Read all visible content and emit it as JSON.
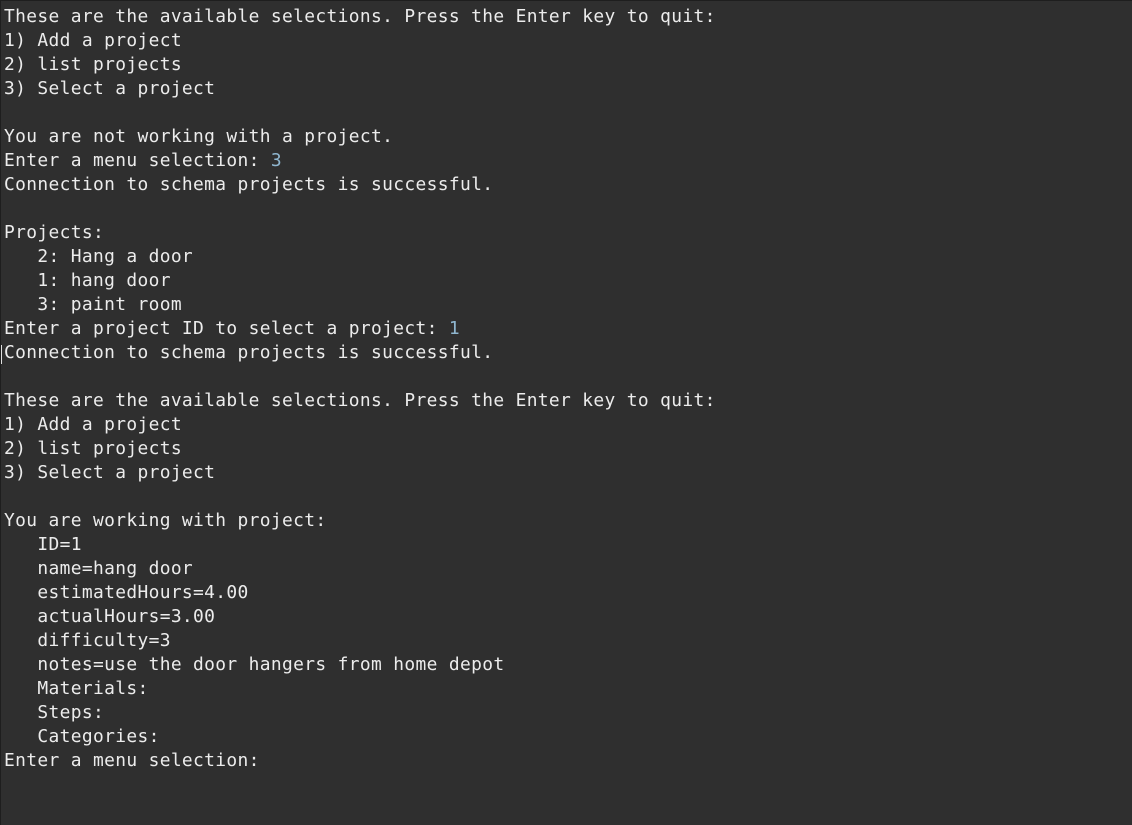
{
  "console": {
    "lines": [
      {
        "text": "These are the available selections. Press the Enter key to quit:",
        "input": ""
      },
      {
        "text": "1) Add a project",
        "input": ""
      },
      {
        "text": "2) list projects",
        "input": ""
      },
      {
        "text": "3) Select a project",
        "input": ""
      },
      {
        "text": "",
        "input": ""
      },
      {
        "text": "You are not working with a project.",
        "input": ""
      },
      {
        "text": "Enter a menu selection: ",
        "input": "3"
      },
      {
        "text": "Connection to schema projects is successful.",
        "input": ""
      },
      {
        "text": "",
        "input": ""
      },
      {
        "text": "Projects:",
        "input": ""
      },
      {
        "text": "   2: Hang a door",
        "input": ""
      },
      {
        "text": "   1: hang door",
        "input": ""
      },
      {
        "text": "   3: paint room",
        "input": ""
      },
      {
        "text": "Enter a project ID to select a project: ",
        "input": "1"
      },
      {
        "text": "Connection to schema projects is successful.",
        "input": ""
      },
      {
        "text": "",
        "input": ""
      },
      {
        "text": "These are the available selections. Press the Enter key to quit:",
        "input": ""
      },
      {
        "text": "1) Add a project",
        "input": ""
      },
      {
        "text": "2) list projects",
        "input": ""
      },
      {
        "text": "3) Select a project",
        "input": ""
      },
      {
        "text": "",
        "input": ""
      },
      {
        "text": "You are working with project:",
        "input": ""
      },
      {
        "text": "   ID=1",
        "input": ""
      },
      {
        "text": "   name=hang door",
        "input": ""
      },
      {
        "text": "   estimatedHours=4.00",
        "input": ""
      },
      {
        "text": "   actualHours=3.00",
        "input": ""
      },
      {
        "text": "   difficulty=3",
        "input": ""
      },
      {
        "text": "   notes=use the door hangers from home depot",
        "input": ""
      },
      {
        "text": "   Materials:",
        "input": ""
      },
      {
        "text": "   Steps:",
        "input": ""
      },
      {
        "text": "   Categories:",
        "input": ""
      },
      {
        "text": "Enter a menu selection: ",
        "input": ""
      }
    ]
  },
  "colors": {
    "background": "#2f2f2f",
    "text": "#ececec",
    "user_input": "#8fb6cf"
  }
}
